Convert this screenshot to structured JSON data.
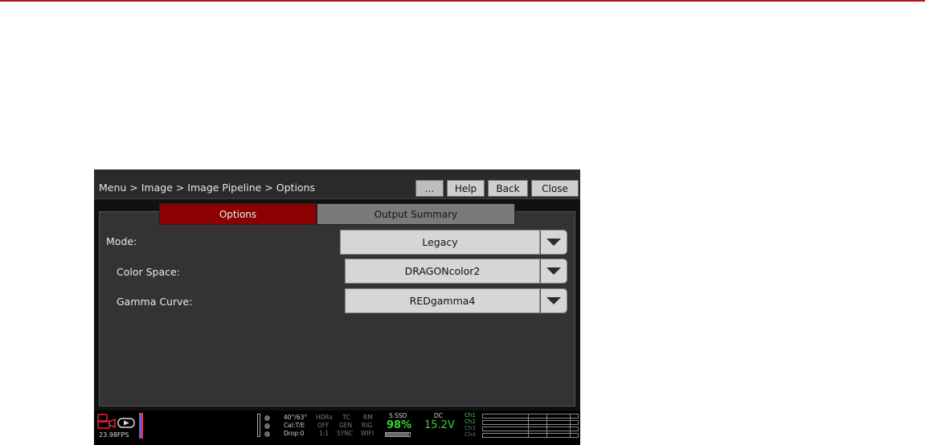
{
  "header": {
    "breadcrumb": "Menu > Image > Image Pipeline > Options",
    "more_label": "...",
    "help_label": "Help",
    "back_label": "Back",
    "close_label": "Close"
  },
  "tabs": [
    {
      "label": "Options",
      "active": true
    },
    {
      "label": "Output Summary",
      "active": false
    }
  ],
  "rows": [
    {
      "label": "Mode:",
      "value": "Legacy"
    },
    {
      "label": "Color Space:",
      "value": "DRAGONcolor2"
    },
    {
      "label": "Gamma Curve:",
      "value": "REDgamma4"
    }
  ],
  "status": {
    "fps": "23.98FPS",
    "temps": "40°/63°",
    "cal": "Cal:T/E",
    "drop": "Drop:0",
    "hdrx_label": "HDRx",
    "hdrx_value": "OFF",
    "hdrx_ratio": "1:1",
    "tc_label": "TC",
    "tc_value": "GEN",
    "tc_sync": "SYNC",
    "rm_label": "RM",
    "rm_value": "RIG",
    "rm_wifi": "WIFI",
    "media_label": "S.SSD",
    "media_pct": "98%",
    "dc_label": "DC",
    "voltage": "15.2V",
    "ch1": "Ch1",
    "ch2": "Ch2",
    "ch3": "Ch3",
    "ch4": "Ch4"
  },
  "colors": {
    "accent_red": "#8b0000",
    "status_green": "#3bd13b"
  }
}
